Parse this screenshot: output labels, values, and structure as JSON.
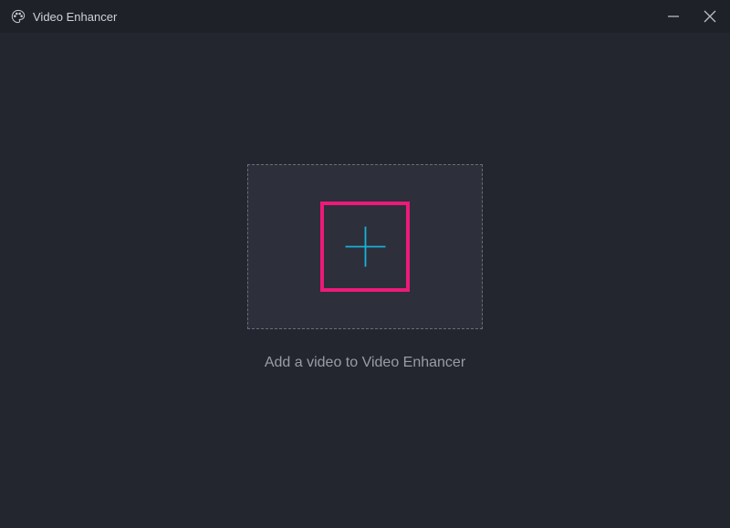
{
  "titlebar": {
    "app_title": "Video Enhancer"
  },
  "main": {
    "instruction": "Add a video to Video Enhancer"
  },
  "colors": {
    "highlight": "#ec1a7a",
    "plus_icon": "#19b0d8"
  }
}
